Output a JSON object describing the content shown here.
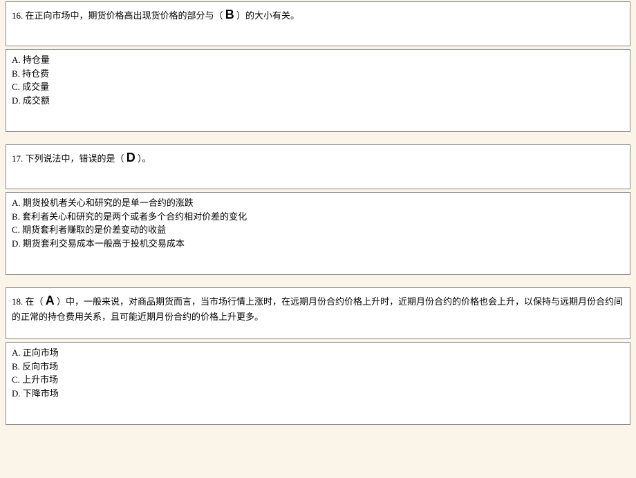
{
  "questions": [
    {
      "number": "16.",
      "text_before": "在正向市场中，期货价格高出现货价格的部分与（",
      "answer": "B",
      "text_after": "）的大小有关。",
      "options": {
        "a": "A. 持仓量",
        "b": "B. 持仓费",
        "c": "C. 成交量",
        "d": "D. 成交额"
      }
    },
    {
      "number": "17.",
      "text_before": "下列说法中，错误的是（",
      "answer": "D",
      "text_after": "）。",
      "options": {
        "a": "A. 期货投机者关心和研究的是单一合约的涨跌",
        "b": "B. 套利者关心和研究的是两个或者多个合约相对价差的变化",
        "c": "C. 期货套利者赚取的是价差变动的收益",
        "d": "D. 期货套利交易成本一般高于投机交易成本"
      }
    },
    {
      "number": "18.",
      "text_before": "在（",
      "answer": "A",
      "text_after": "）中，一般来说，对商品期货而言，当市场行情上涨时，在远期月份合约价格上升时，近期月份合约的价格也会上升，以保持与远期月份合约间的正常的持仓费用关系，且可能近期月份合约的价格上升更多。",
      "options": {
        "a": "A. 正向市场",
        "b": "B. 反向市场",
        "c": "C. 上升市场",
        "d": "D. 下降市场"
      }
    }
  ]
}
